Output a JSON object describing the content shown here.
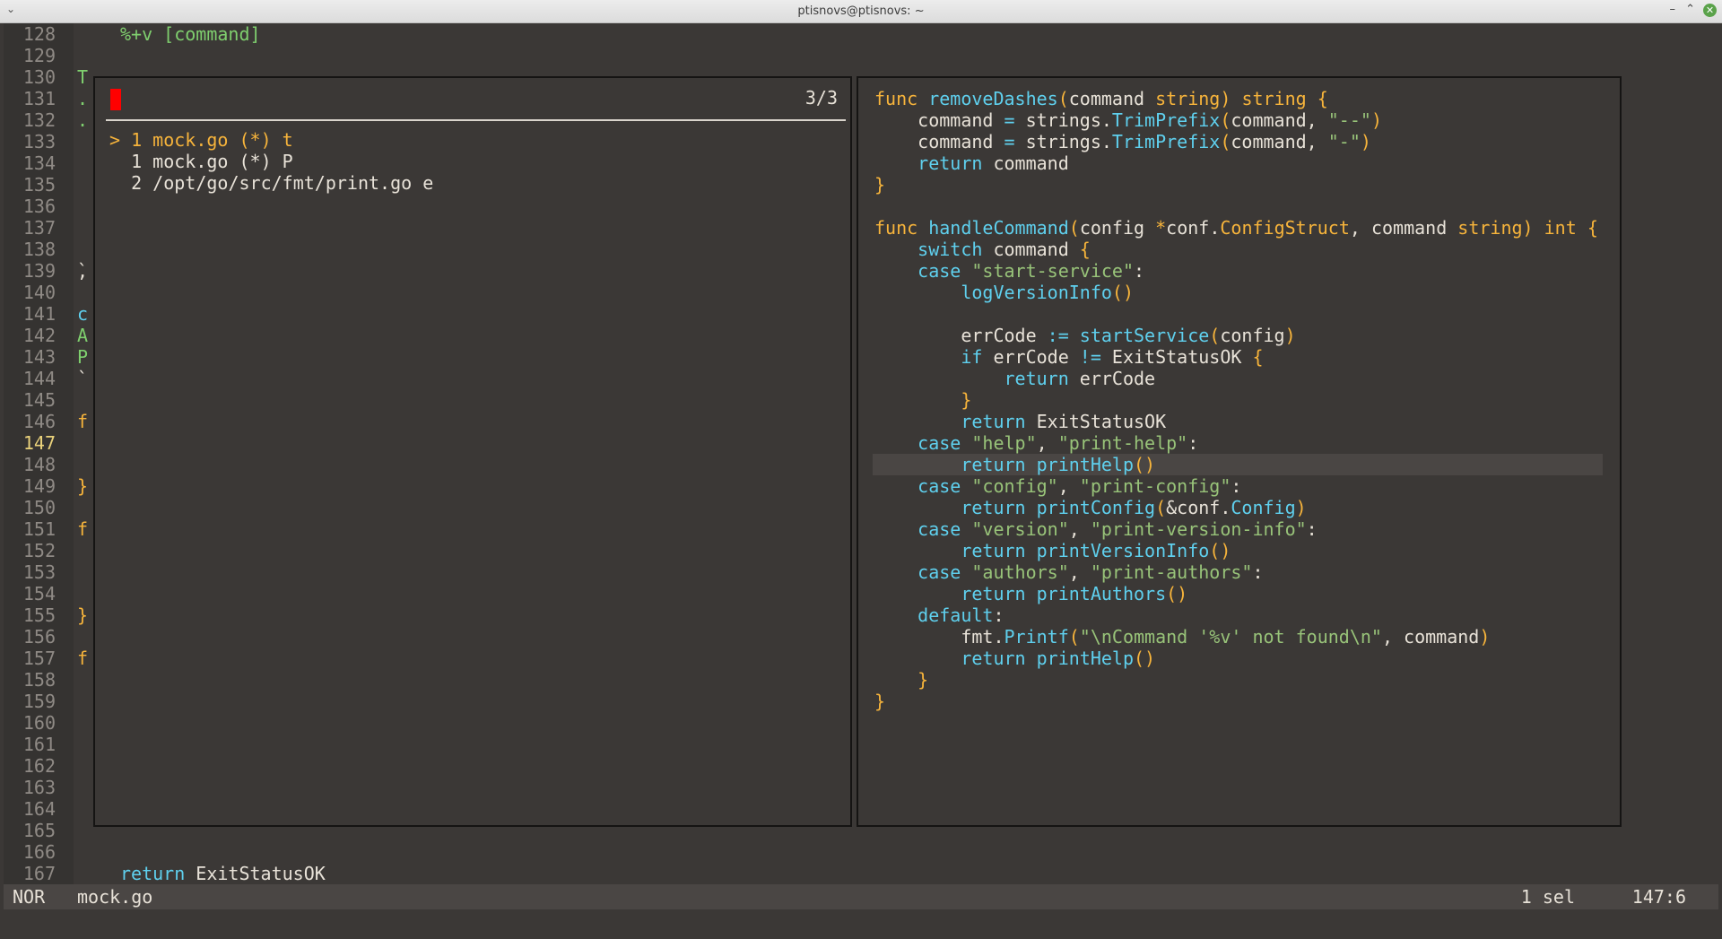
{
  "window": {
    "title": "ptisnovs@ptisnovs: ~",
    "menu_glyph": "⌄",
    "minimize_glyph": "–",
    "maximize_glyph": "⌃",
    "close_glyph": "✕"
  },
  "editor": {
    "line_numbers": [
      "128",
      "129",
      "130",
      "131",
      "132",
      "133",
      "134",
      "135",
      "136",
      "137",
      "138",
      "139",
      "140",
      "141",
      "142",
      "143",
      "144",
      "145",
      "146",
      "147",
      "148",
      "149",
      "150",
      "151",
      "152",
      "153",
      "154",
      "155",
      "156",
      "157",
      "158",
      "159",
      "160",
      "161",
      "162",
      "163",
      "164",
      "165",
      "166",
      "167"
    ],
    "current_line": "147",
    "top_line_text": "%+v [command]",
    "bottom_line_keyword": "return",
    "bottom_line_text": " ExitStatusOK",
    "left_fragments": [
      {
        "row": 2,
        "text": "T",
        "color": "#7fcf6e"
      },
      {
        "row": 3,
        "text": ".",
        "color": "#7fcf6e"
      },
      {
        "row": 4,
        "text": ".",
        "color": "#7fcf6e"
      },
      {
        "row": 11,
        "text": "`",
        "color": "#e8e2d8"
      },
      {
        "row": 11,
        "text": ",",
        "color": "#e8e2d8"
      },
      {
        "row": 13,
        "text": "c",
        "color": "#5fd0ee"
      },
      {
        "row": 14,
        "text": "A",
        "color": "#7fcf6e"
      },
      {
        "row": 15,
        "text": "P",
        "color": "#7fcf6e"
      },
      {
        "row": 16,
        "text": "`",
        "color": "#e8e2d8"
      },
      {
        "row": 18,
        "text": "f",
        "color": "#f7b43b"
      },
      {
        "row": 21,
        "text": "}",
        "color": "#f7b43b"
      },
      {
        "row": 23,
        "text": "f",
        "color": "#f7b43b"
      },
      {
        "row": 27,
        "text": "}",
        "color": "#f7b43b"
      },
      {
        "row": 29,
        "text": "f",
        "color": "#f7b43b"
      }
    ]
  },
  "picker": {
    "count": "3/3",
    "items": [
      {
        "marker": ">",
        "text": " 1 mock.go (*) t",
        "selected": true
      },
      {
        "marker": " ",
        "text": " 1 mock.go (*) P",
        "selected": false
      },
      {
        "marker": " ",
        "text": " 2 /opt/go/src/fmt/print.go e",
        "selected": false
      }
    ]
  },
  "preview": {
    "highlight_row": 17,
    "lines": [
      [
        [
          "k",
          "func "
        ],
        [
          "f",
          "removeDashes"
        ],
        [
          "p",
          "("
        ],
        [
          "t",
          "command "
        ],
        [
          "k",
          "string"
        ],
        [
          "p",
          ") "
        ],
        [
          "k",
          "string "
        ],
        [
          "p",
          "{"
        ]
      ],
      [
        [
          "t",
          "    command "
        ],
        [
          "f",
          "= "
        ],
        [
          "t",
          "strings."
        ],
        [
          "f",
          "TrimPrefix"
        ],
        [
          "p",
          "("
        ],
        [
          "t",
          "command, "
        ],
        [
          "s",
          "\"--\""
        ],
        [
          "p",
          ")"
        ]
      ],
      [
        [
          "t",
          "    command "
        ],
        [
          "f",
          "= "
        ],
        [
          "t",
          "strings."
        ],
        [
          "f",
          "TrimPrefix"
        ],
        [
          "p",
          "("
        ],
        [
          "t",
          "command, "
        ],
        [
          "s",
          "\"-\""
        ],
        [
          "p",
          ")"
        ]
      ],
      [
        [
          "k",
          "    "
        ],
        [
          "f",
          "return "
        ],
        [
          "t",
          "command"
        ]
      ],
      [
        [
          "p",
          "}"
        ]
      ],
      [
        [
          "t",
          ""
        ]
      ],
      [
        [
          "k",
          "func "
        ],
        [
          "f",
          "handleCommand"
        ],
        [
          "p",
          "("
        ],
        [
          "t",
          "config "
        ],
        [
          "k",
          "*"
        ],
        [
          "t",
          "conf."
        ],
        [
          "k",
          "ConfigStruct"
        ],
        [
          "t",
          ", command "
        ],
        [
          "k",
          "string"
        ],
        [
          "p",
          ") "
        ],
        [
          "k",
          "int "
        ],
        [
          "p",
          "{"
        ]
      ],
      [
        [
          "f",
          "    switch "
        ],
        [
          "t",
          "command "
        ],
        [
          "p",
          "{"
        ]
      ],
      [
        [
          "f",
          "    case "
        ],
        [
          "s",
          "\"start-service\""
        ],
        [
          "t",
          ":"
        ]
      ],
      [
        [
          "f",
          "        logVersionInfo"
        ],
        [
          "p",
          "()"
        ]
      ],
      [
        [
          "t",
          ""
        ]
      ],
      [
        [
          "t",
          "        errCode "
        ],
        [
          "f",
          ":= "
        ],
        [
          "f",
          "startService"
        ],
        [
          "p",
          "("
        ],
        [
          "t",
          "config"
        ],
        [
          "p",
          ")"
        ]
      ],
      [
        [
          "f",
          "        if "
        ],
        [
          "t",
          "errCode "
        ],
        [
          "f",
          "!= "
        ],
        [
          "t",
          "ExitStatusOK "
        ],
        [
          "p",
          "{"
        ]
      ],
      [
        [
          "f",
          "            return "
        ],
        [
          "t",
          "errCode"
        ]
      ],
      [
        [
          "p",
          "        }"
        ]
      ],
      [
        [
          "f",
          "        return "
        ],
        [
          "t",
          "ExitStatusOK"
        ]
      ],
      [
        [
          "f",
          "    case "
        ],
        [
          "s",
          "\"help\""
        ],
        [
          "t",
          ", "
        ],
        [
          "s",
          "\"print-help\""
        ],
        [
          "t",
          ":"
        ]
      ],
      [
        [
          "f",
          "        return "
        ],
        [
          "f",
          "printHelp"
        ],
        [
          "p",
          "()"
        ]
      ],
      [
        [
          "f",
          "    case "
        ],
        [
          "s",
          "\"config\""
        ],
        [
          "t",
          ", "
        ],
        [
          "s",
          "\"print-config\""
        ],
        [
          "t",
          ":"
        ]
      ],
      [
        [
          "f",
          "        return "
        ],
        [
          "f",
          "printConfig"
        ],
        [
          "p",
          "("
        ],
        [
          "t",
          "&conf."
        ],
        [
          "f",
          "Config"
        ],
        [
          "p",
          ")"
        ]
      ],
      [
        [
          "f",
          "    case "
        ],
        [
          "s",
          "\"version\""
        ],
        [
          "t",
          ", "
        ],
        [
          "s",
          "\"print-version-info\""
        ],
        [
          "t",
          ":"
        ]
      ],
      [
        [
          "f",
          "        return "
        ],
        [
          "f",
          "printVersionInfo"
        ],
        [
          "p",
          "()"
        ]
      ],
      [
        [
          "f",
          "    case "
        ],
        [
          "s",
          "\"authors\""
        ],
        [
          "t",
          ", "
        ],
        [
          "s",
          "\"print-authors\""
        ],
        [
          "t",
          ":"
        ]
      ],
      [
        [
          "f",
          "        return "
        ],
        [
          "f",
          "printAuthors"
        ],
        [
          "p",
          "()"
        ]
      ],
      [
        [
          "f",
          "    default"
        ],
        [
          "t",
          ":"
        ]
      ],
      [
        [
          "t",
          "        fmt."
        ],
        [
          "f",
          "Printf"
        ],
        [
          "p",
          "("
        ],
        [
          "s",
          "\"\\nCommand '%v' not found\\n\""
        ],
        [
          "t",
          ", command"
        ],
        [
          "p",
          ")"
        ]
      ],
      [
        [
          "f",
          "        return "
        ],
        [
          "f",
          "printHelp"
        ],
        [
          "p",
          "()"
        ]
      ],
      [
        [
          "p",
          "    }"
        ]
      ],
      [
        [
          "p",
          "}"
        ]
      ]
    ]
  },
  "statusbar": {
    "mode": "NOR",
    "file": "mock.go",
    "selection": "1 sel",
    "position": "147:6"
  }
}
